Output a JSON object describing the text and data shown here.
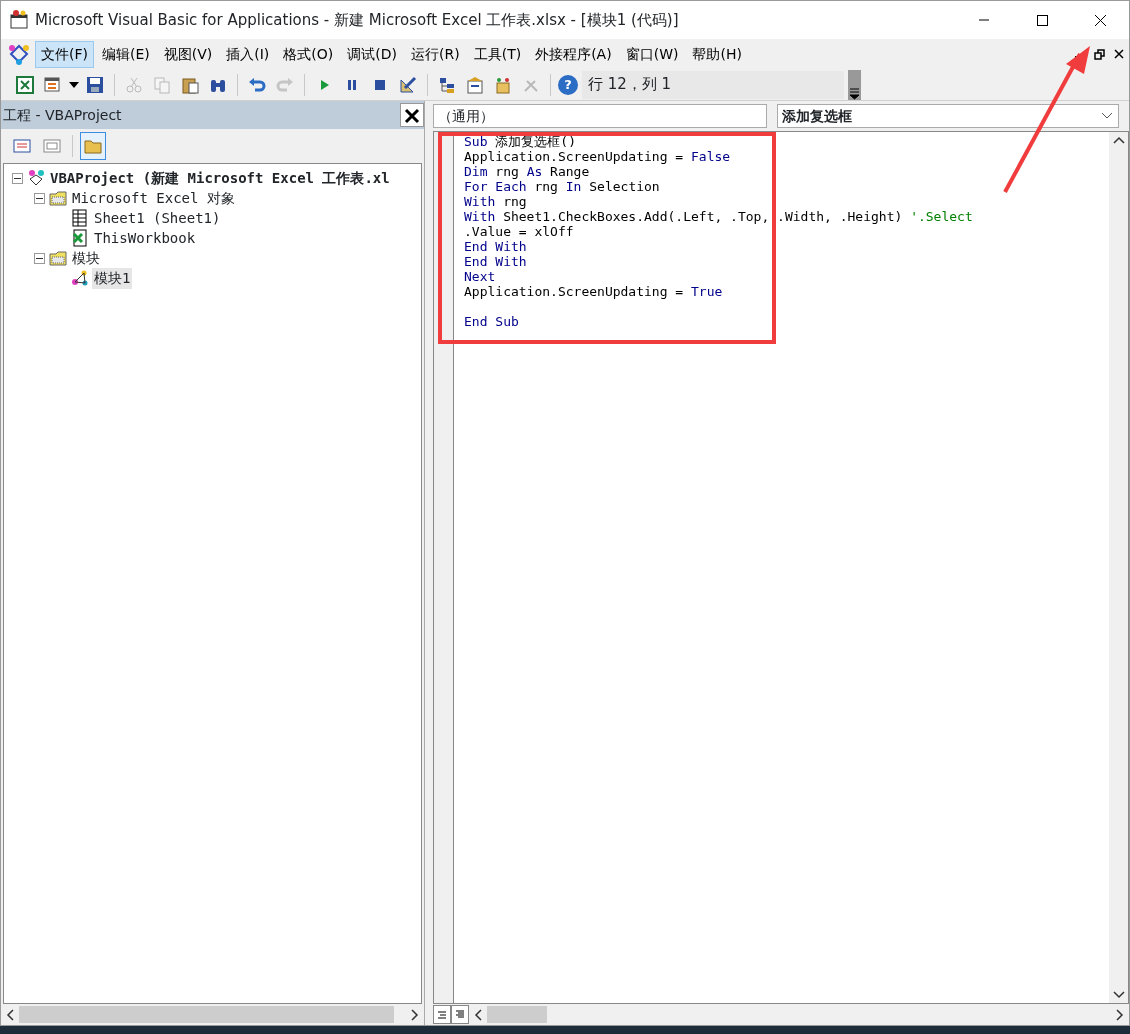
{
  "window": {
    "title": "Microsoft Visual Basic for Applications - 新建 Microsoft Excel 工作表.xlsx - [模块1 (代码)]"
  },
  "menu": [
    {
      "label": "文件(F)",
      "selected": true
    },
    {
      "label": "编辑(E)",
      "selected": false
    },
    {
      "label": "视图(V)",
      "selected": false
    },
    {
      "label": "插入(I)",
      "selected": false
    },
    {
      "label": "格式(O)",
      "selected": false
    },
    {
      "label": "调试(D)",
      "selected": false
    },
    {
      "label": "运行(R)",
      "selected": false
    },
    {
      "label": "工具(T)",
      "selected": false
    },
    {
      "label": "外接程序(A)",
      "selected": false
    },
    {
      "label": "窗口(W)",
      "selected": false
    },
    {
      "label": "帮助(H)",
      "selected": false
    }
  ],
  "toolbar": [
    {
      "kind": "excel",
      "disabled": false
    },
    {
      "kind": "insert",
      "disabled": false
    },
    {
      "kind": "save",
      "disabled": false
    },
    {
      "kind": "sep"
    },
    {
      "kind": "cut",
      "disabled": true
    },
    {
      "kind": "copy",
      "disabled": true
    },
    {
      "kind": "paste",
      "disabled": false
    },
    {
      "kind": "find",
      "disabled": false
    },
    {
      "kind": "sep"
    },
    {
      "kind": "undo",
      "disabled": false
    },
    {
      "kind": "redo",
      "disabled": true
    },
    {
      "kind": "sep"
    },
    {
      "kind": "run",
      "disabled": false
    },
    {
      "kind": "pause",
      "disabled": false
    },
    {
      "kind": "stop",
      "disabled": false
    },
    {
      "kind": "design",
      "disabled": false
    },
    {
      "kind": "sep"
    },
    {
      "kind": "explorer",
      "disabled": false
    },
    {
      "kind": "properties",
      "disabled": false
    },
    {
      "kind": "browser",
      "disabled": false
    },
    {
      "kind": "toolbox",
      "disabled": true
    },
    {
      "kind": "sep"
    },
    {
      "kind": "help",
      "label": "?",
      "disabled": false
    }
  ],
  "position": "行 12，列 1",
  "project_panel": {
    "title": "工程 - VBAProject",
    "tools": [
      {
        "kind": "view-code",
        "selected": false
      },
      {
        "kind": "view-object",
        "selected": false
      },
      {
        "kind": "toggle-folders",
        "selected": true
      }
    ],
    "tree": [
      {
        "label": "VBAProject (新建 Microsoft Excel 工作表.xl",
        "kind": "project",
        "bold": true,
        "expanded": true,
        "selected": false,
        "children": [
          {
            "label": "Microsoft Excel 对象",
            "kind": "folder",
            "bold": false,
            "expanded": true,
            "selected": false,
            "children": [
              {
                "label": "Sheet1 (Sheet1)",
                "kind": "sheet",
                "bold": false,
                "selected": false
              },
              {
                "label": "ThisWorkbook",
                "kind": "workbook",
                "bold": false,
                "selected": false
              }
            ]
          },
          {
            "label": "模块",
            "kind": "folder",
            "bold": false,
            "expanded": true,
            "selected": false,
            "children": [
              {
                "label": "模块1",
                "kind": "module",
                "bold": false,
                "selected": true
              }
            ]
          }
        ]
      }
    ]
  },
  "code_window": {
    "object_dropdown": "（通用）",
    "procedure_dropdown": "添加复选框",
    "lines": [
      {
        "blank_line_before": false,
        "segments": [
          {
            "text": "Sub",
            "kind": "keyword"
          },
          {
            "text": " 添加复选框()",
            "kind": "plain"
          }
        ]
      },
      {
        "blank_line_before": false,
        "segments": [
          {
            "text": "Application.ScreenUpdating = ",
            "kind": "plain"
          },
          {
            "text": "False",
            "kind": "keyword"
          }
        ]
      },
      {
        "blank_line_before": false,
        "segments": [
          {
            "text": "Dim",
            "kind": "keyword"
          },
          {
            "text": " rng ",
            "kind": "plain"
          },
          {
            "text": "As",
            "kind": "keyword"
          },
          {
            "text": " Range",
            "kind": "plain"
          }
        ]
      },
      {
        "blank_line_before": false,
        "segments": [
          {
            "text": "For Each",
            "kind": "keyword"
          },
          {
            "text": " rng ",
            "kind": "plain"
          },
          {
            "text": "In",
            "kind": "keyword"
          },
          {
            "text": " Selection",
            "kind": "plain"
          }
        ]
      },
      {
        "blank_line_before": false,
        "segments": [
          {
            "text": "With",
            "kind": "keyword"
          },
          {
            "text": " rng",
            "kind": "plain"
          }
        ]
      },
      {
        "blank_line_before": false,
        "segments": [
          {
            "text": "With",
            "kind": "keyword"
          },
          {
            "text": " Sheet1.CheckBoxes.Add(.Left, .Top, .Width, .Height) ",
            "kind": "plain"
          },
          {
            "text": "'.Select",
            "kind": "comment"
          }
        ]
      },
      {
        "blank_line_before": false,
        "segments": [
          {
            "text": ".Value = xlOff",
            "kind": "plain"
          }
        ]
      },
      {
        "blank_line_before": false,
        "segments": [
          {
            "text": "End With",
            "kind": "keyword"
          }
        ]
      },
      {
        "blank_line_before": false,
        "segments": [
          {
            "text": "End With",
            "kind": "keyword"
          }
        ]
      },
      {
        "blank_line_before": false,
        "segments": [
          {
            "text": "Next",
            "kind": "keyword"
          }
        ]
      },
      {
        "blank_line_before": false,
        "segments": [
          {
            "text": "Application.ScreenUpdating = ",
            "kind": "plain"
          },
          {
            "text": "True",
            "kind": "keyword"
          }
        ]
      },
      {
        "blank_line_before": true,
        "segments": [
          {
            "text": "End Sub",
            "kind": "keyword"
          }
        ]
      }
    ]
  }
}
